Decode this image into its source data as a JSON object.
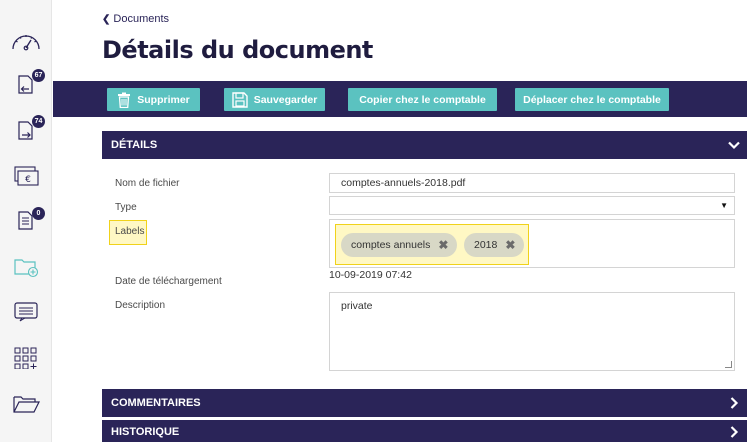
{
  "breadcrumb": {
    "label": "Documents"
  },
  "page": {
    "title": "Détails du document"
  },
  "sidebar": {
    "items": [
      {
        "icon": "speedometer-icon",
        "badge": ""
      },
      {
        "icon": "inbox-in-icon",
        "badge": "67"
      },
      {
        "icon": "inbox-out-icon",
        "badge": "74"
      },
      {
        "icon": "invoice-euro-icon",
        "badge": ""
      },
      {
        "icon": "document-list-icon",
        "badge": "0"
      },
      {
        "icon": "folder-add-icon",
        "badge": ""
      },
      {
        "icon": "message-icon",
        "badge": ""
      },
      {
        "icon": "grid-add-icon",
        "badge": ""
      },
      {
        "icon": "folder-open-icon",
        "badge": ""
      }
    ]
  },
  "toolbar": {
    "delete_label": "Supprimer",
    "save_label": "Sauvegarder",
    "copy_label": "Copier chez le comptable",
    "move_label": "Déplacer chez le comptable"
  },
  "details": {
    "header": "DÉTAILS",
    "filename_label": "Nom de fichier",
    "filename_value": "comptes-annuels-2018.pdf",
    "type_label": "Type",
    "type_value": "",
    "labels_label": "Labels",
    "labels": [
      "comptes annuels",
      "2018"
    ],
    "upload_date_label": "Date de téléchargement",
    "upload_date_value": "10-09-2019 07:42",
    "description_label": "Description",
    "description_value": "private"
  },
  "comments": {
    "header": "COMMENTAIRES"
  },
  "history": {
    "header": "HISTORIQUE"
  },
  "colors": {
    "navy": "#2a2458",
    "teal": "#5bc2c0",
    "highlight": "#fff8c4",
    "highlight_border": "#f0d21a",
    "tag": "#d8d8c6"
  }
}
